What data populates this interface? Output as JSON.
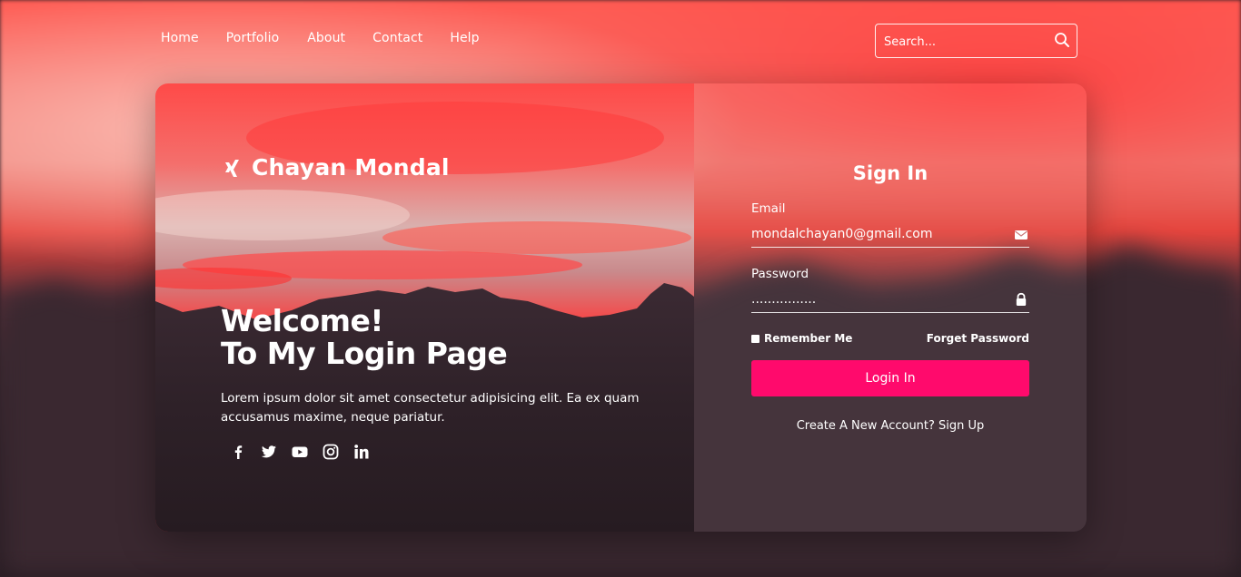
{
  "nav": {
    "links": [
      "Home",
      "Portfolio",
      "About",
      "Contact",
      "Help"
    ]
  },
  "search": {
    "placeholder": "Search...",
    "icon": "search-icon"
  },
  "hero": {
    "brand_icon": "xing-icon",
    "brand_name": "Chayan Mondal",
    "welcome_line1": "Welcome!",
    "welcome_line2": "To My Login Page",
    "intro": "Lorem ipsum dolor sit amet consectetur adipisicing elit. Ea ex quam accusamus maxime, neque pariatur.",
    "social_icons": [
      "facebook-icon",
      "twitter-icon",
      "youtube-icon",
      "instagram-icon",
      "linkedin-icon"
    ]
  },
  "form": {
    "title": "Sign In",
    "email_label": "Email",
    "email_value": "mondalchayan0@gmail.com",
    "email_icon": "envelope-icon",
    "password_label": "Password",
    "password_value": "................",
    "password_icon": "lock-icon",
    "remember_label": "Remember Me",
    "forget_label": "Forget Password",
    "login_label": "Login In",
    "signup_label": "Create A New Account? Sign Up"
  },
  "colors": {
    "accent": "#ff0a6c",
    "sky_red": "#ff4d4d",
    "background_dark": "#2a1d24"
  }
}
